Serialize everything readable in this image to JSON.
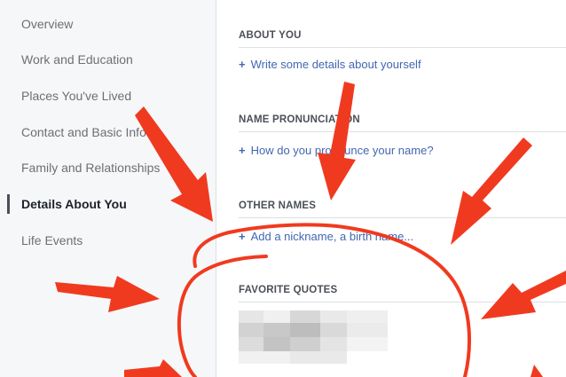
{
  "sidebar": {
    "items": [
      {
        "label": "Overview",
        "active": false
      },
      {
        "label": "Work and Education",
        "active": false
      },
      {
        "label": "Places You've Lived",
        "active": false
      },
      {
        "label": "Contact and Basic Info",
        "active": false
      },
      {
        "label": "Family and Relationships",
        "active": false
      },
      {
        "label": "Details About You",
        "active": true
      },
      {
        "label": "Life Events",
        "active": false
      }
    ]
  },
  "sections": [
    {
      "title": "ABOUT YOU",
      "action": "Write some details about yourself"
    },
    {
      "title": "NAME PRONUNCIATION",
      "action": "How do you pronounce your name?"
    },
    {
      "title": "OTHER NAMES",
      "action": "Add a nickname, a birth name..."
    },
    {
      "title": "FAVORITE QUOTES",
      "action": ""
    }
  ],
  "colors": {
    "link": "#4267b2",
    "annotation": "#f03a1f",
    "sidebar_bg": "#f6f7f9"
  },
  "icons": {
    "plus": "+"
  },
  "annotations": {
    "arrow_count": 7,
    "highlight_target": "OTHER NAMES / FAVORITE QUOTES"
  }
}
